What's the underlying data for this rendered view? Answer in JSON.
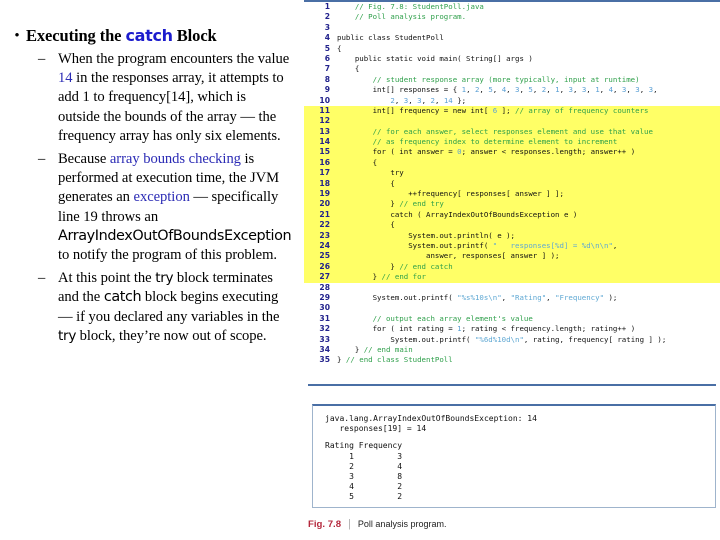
{
  "slide": {
    "bullet_marker": "•",
    "dash_marker": "–",
    "title_pre": "Executing the ",
    "title_kw": "catch",
    "title_post": " Block",
    "points": [
      {
        "id": "point-1",
        "segments": [
          {
            "text": "When the program encounters the value ",
            "style": "plain"
          },
          {
            "text": "14",
            "style": "blue"
          },
          {
            "text": " in the responses array, it attempts to add 1 to frequency[14], which is outside the bounds of the array — the frequency array has only six elements.",
            "style": "plain"
          }
        ]
      },
      {
        "id": "point-2",
        "segments": [
          {
            "text": "Because ",
            "style": "plain"
          },
          {
            "text": "array bounds checking",
            "style": "blue"
          },
          {
            "text": " is performed at execution time, the JVM generates an ",
            "style": "plain"
          },
          {
            "text": "exception",
            "style": "blue"
          },
          {
            "text": " — specifically line 19 throws an ",
            "style": "plain"
          },
          {
            "text": "ArrayIndexOutOfBoundsException",
            "style": "mono-big"
          },
          {
            "text": " to notify the program of this problem.",
            "style": "plain"
          }
        ]
      },
      {
        "id": "point-3",
        "segments": [
          {
            "text": "At this point the ",
            "style": "plain"
          },
          {
            "text": "try",
            "style": "mono"
          },
          {
            "text": " block terminates and the ",
            "style": "plain"
          },
          {
            "text": "catch",
            "style": "mono-big"
          },
          {
            "text": " block begins executing — if you declared any variables in the ",
            "style": "plain"
          },
          {
            "text": "try",
            "style": "mono"
          },
          {
            "text": " block, they’re now out of scope.",
            "style": "plain"
          }
        ]
      }
    ]
  },
  "figure": {
    "code_lines": [
      {
        "n": "1",
        "text": "// Fig. 7.8: StudentPoll.java",
        "indent": 1,
        "kind": "comment",
        "hl": false
      },
      {
        "n": "2",
        "text": "// Poll analysis program.",
        "indent": 1,
        "kind": "comment",
        "hl": false
      },
      {
        "n": "3",
        "text": "",
        "indent": 0,
        "kind": "code",
        "hl": false
      },
      {
        "n": "4",
        "text": "public class StudentPoll",
        "indent": 0,
        "kind": "code",
        "hl": false
      },
      {
        "n": "5",
        "text": "{",
        "indent": 0,
        "kind": "code",
        "hl": false
      },
      {
        "n": "6",
        "text": "public static void main( String[] args )",
        "indent": 1,
        "kind": "code",
        "hl": false
      },
      {
        "n": "7",
        "text": "{",
        "indent": 1,
        "kind": "code",
        "hl": false
      },
      {
        "n": "8",
        "text": "// student response array (more typically, input at runtime)",
        "indent": 2,
        "kind": "comment",
        "hl": false
      },
      {
        "n": "9",
        "text": "int[] responses = { 1, 2, 5, 4, 3, 5, 2, 1, 3, 3, 1, 4, 3, 3, 3,",
        "indent": 2,
        "kind": "code",
        "hl": false
      },
      {
        "n": "10",
        "text": "2, 3, 3, 2, 14 };",
        "indent": 3,
        "kind": "code",
        "hl": false
      },
      {
        "n": "11",
        "text": "int[] frequency = new int[ 6 ]; // array of frequency counters",
        "indent": 2,
        "kind": "code",
        "hl": true
      },
      {
        "n": "12",
        "text": "",
        "indent": 0,
        "kind": "code",
        "hl": true
      },
      {
        "n": "13",
        "text": "// for each answer, select responses element and use that value",
        "indent": 2,
        "kind": "comment",
        "hl": true
      },
      {
        "n": "14",
        "text": "// as frequency index to determine element to increment",
        "indent": 2,
        "kind": "comment",
        "hl": true
      },
      {
        "n": "15",
        "text": "for ( int answer = 0; answer < responses.length; answer++ )",
        "indent": 2,
        "kind": "code",
        "hl": true
      },
      {
        "n": "16",
        "text": "{",
        "indent": 2,
        "kind": "code",
        "hl": true
      },
      {
        "n": "17",
        "text": "try",
        "indent": 3,
        "kind": "code",
        "hl": true
      },
      {
        "n": "18",
        "text": "{",
        "indent": 3,
        "kind": "code",
        "hl": true
      },
      {
        "n": "19",
        "text": "++frequency[ responses[ answer ] ];",
        "indent": 4,
        "kind": "code",
        "hl": true
      },
      {
        "n": "20",
        "text": "} // end try",
        "indent": 3,
        "kind": "code",
        "hl": true
      },
      {
        "n": "21",
        "text": "catch ( ArrayIndexOutOfBoundsException e )",
        "indent": 3,
        "kind": "code",
        "hl": true
      },
      {
        "n": "22",
        "text": "{",
        "indent": 3,
        "kind": "code",
        "hl": true
      },
      {
        "n": "23",
        "text": "System.out.println( e );",
        "indent": 4,
        "kind": "code",
        "hl": true
      },
      {
        "n": "24",
        "text": "System.out.printf( \"   responses[%d] = %d\\n\\n\",",
        "indent": 4,
        "kind": "code",
        "hl": true
      },
      {
        "n": "25",
        "text": "answer, responses[ answer ] );",
        "indent": 5,
        "kind": "code",
        "hl": true
      },
      {
        "n": "26",
        "text": "} // end catch",
        "indent": 3,
        "kind": "code",
        "hl": true
      },
      {
        "n": "27",
        "text": "} // end for",
        "indent": 2,
        "kind": "code",
        "hl": true
      },
      {
        "n": "28",
        "text": "",
        "indent": 0,
        "kind": "code",
        "hl": false
      },
      {
        "n": "29",
        "text": "System.out.printf( \"%s%10s\\n\", \"Rating\", \"Frequency\" );",
        "indent": 2,
        "kind": "code",
        "hl": false
      },
      {
        "n": "30",
        "text": "",
        "indent": 0,
        "kind": "code",
        "hl": false
      },
      {
        "n": "31",
        "text": "// output each array element's value",
        "indent": 2,
        "kind": "comment",
        "hl": false
      },
      {
        "n": "32",
        "text": "for ( int rating = 1; rating < frequency.length; rating++ )",
        "indent": 2,
        "kind": "code",
        "hl": false
      },
      {
        "n": "33",
        "text": "System.out.printf( \"%6d%10d\\n\", rating, frequency[ rating ] );",
        "indent": 3,
        "kind": "code",
        "hl": false
      },
      {
        "n": "34",
        "text": "} // end main",
        "indent": 1,
        "kind": "code",
        "hl": false
      },
      {
        "n": "35",
        "text": "} // end class StudentPoll",
        "indent": 0,
        "kind": "code",
        "hl": false
      }
    ],
    "output_lines": [
      "java.lang.ArrayIndexOutOfBoundsException: 14",
      "   responses[19] = 14",
      "",
      "Rating Frequency",
      "     1         3",
      "     2         4",
      "     3         8",
      "     4         2",
      "     5         2"
    ],
    "caption": {
      "fig_label": "Fig. 7.8",
      "separator": "|",
      "text": "Poll analysis program."
    }
  },
  "colors": {
    "highlight": "#ffff66",
    "line_number": "#22228c",
    "comment": "#2e9f4a",
    "string": "#5fa8d3",
    "rule": "#4a6fa5",
    "caption_red": "#b4283c",
    "accent_blue": "#1c1ccd"
  }
}
